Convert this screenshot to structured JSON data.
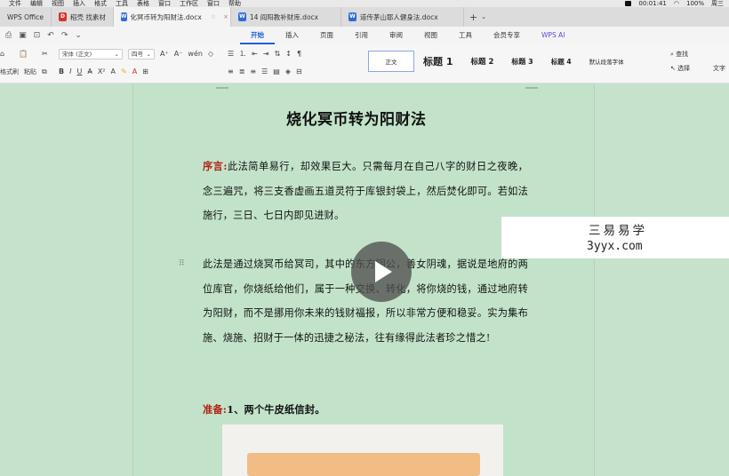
{
  "menubar": {
    "items": [
      "文件",
      "编辑",
      "视图",
      "插入",
      "格式",
      "工具",
      "表格",
      "窗口",
      "工作区",
      "窗口",
      "帮助"
    ],
    "time": "00:01:41",
    "battery": "100%",
    "status_right": "周三"
  },
  "tabs": [
    {
      "label": "WPS Office",
      "icon": "wps-icon"
    },
    {
      "label": "稻壳 找素材",
      "icon": "docer-icon"
    },
    {
      "label": "化冥币转为阳财法.docx",
      "icon": "word-icon",
      "active": true
    },
    {
      "label": "14 阎阳教补财库.docx",
      "icon": "word-icon"
    },
    {
      "label": "道传茅山耶人健身法.docx",
      "icon": "word-icon"
    }
  ],
  "ribbon_tabs": [
    "开始",
    "插入",
    "页面",
    "引用",
    "审阅",
    "视图",
    "工具",
    "会员专享",
    "WPS AI"
  ],
  "toolbar": {
    "format_painter": "格式刷",
    "paste": "粘贴",
    "font_name": "宋体 (正文)",
    "font_size": "四号",
    "styles": {
      "normal": "正文",
      "h1": "标题 1",
      "h2": "标题 2",
      "h3": "标题 3",
      "h4": "标题 4",
      "default": "默认段落字体"
    },
    "find": "查找",
    "select": "选择",
    "text_tools": "文字"
  },
  "document": {
    "title": "烧化冥币转为阳财法",
    "p1_lead": "序言:",
    "p1_text": "此法简单易行，却效果巨大。只需每月在自己八字的财日之夜晚，念三遍咒，将三支香虚画五道灵符于库银封袋上，然后焚化即可。若如法施行，三日、七日内即见进财。",
    "p2_text": "此法是通过烧冥币给冥司，其中的东方阴公，善女阴魂，据说是地府的两位库官，你烧纸给他们，属于一种交换、转化，将你烧的钱，通过地府转为阳财，而不是挪用你未来的钱财福报，所以非常方便和稳妥。实为集布施、烧施、招财于一体的迅捷之秘法，往有缘得此法者珍之惜之!",
    "p3_lead": "准备:",
    "p3_text": "1、两个牛皮纸信封。"
  },
  "watermark": {
    "line1": "三易易学",
    "line2": "3yyx.com"
  },
  "colors": {
    "accent": "#1e5fd6",
    "page_bg": "#c2e3c9",
    "lead_red": "#b02418"
  }
}
